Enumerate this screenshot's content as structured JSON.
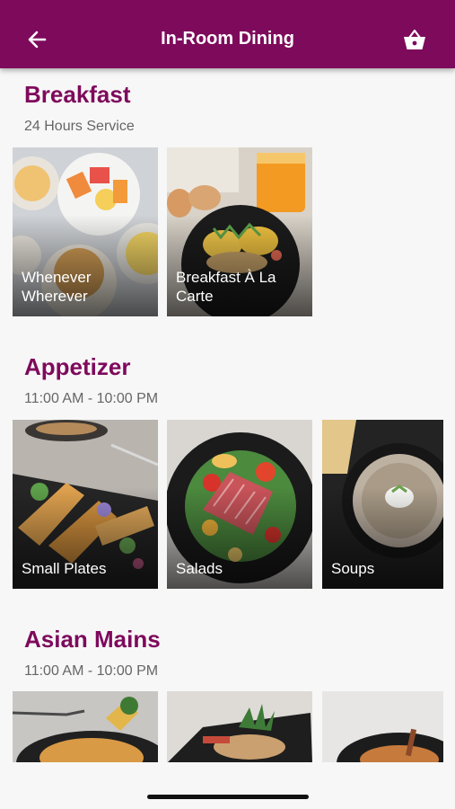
{
  "header": {
    "title": "In-Room Dining"
  },
  "sections": [
    {
      "title": "Breakfast",
      "subtitle": "24 Hours Service",
      "items": [
        {
          "label": "Whenever Wherever"
        },
        {
          "label": "Breakfast À La Carte"
        }
      ]
    },
    {
      "title": "Appetizer",
      "subtitle": "11:00 AM - 10:00 PM",
      "items": [
        {
          "label": "Small Plates"
        },
        {
          "label": "Salads"
        },
        {
          "label": "Soups"
        }
      ]
    },
    {
      "title": "Asian Mains",
      "subtitle": "11:00 AM - 10:00 PM",
      "items": [
        {
          "label": ""
        },
        {
          "label": ""
        },
        {
          "label": ""
        }
      ]
    }
  ],
  "colors": {
    "brand": "#7e0a5c",
    "background": "#f7f7f7"
  },
  "icons": {
    "back": "arrow-left-icon",
    "cart": "basket-icon"
  }
}
